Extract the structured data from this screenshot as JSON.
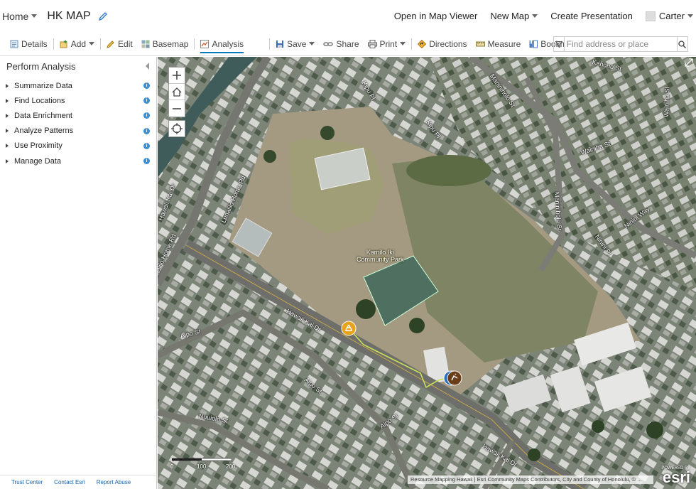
{
  "header": {
    "home_label": "Home",
    "map_title": "HK MAP",
    "open_map_viewer": "Open in Map Viewer",
    "new_map": "New Map",
    "create_presentation": "Create Presentation",
    "user_name": "Carter"
  },
  "toolbar": {
    "details": "Details",
    "add": "Add",
    "edit": "Edit",
    "basemap": "Basemap",
    "analysis": "Analysis",
    "save": "Save",
    "share": "Share",
    "print": "Print",
    "directions": "Directions",
    "measure": "Measure",
    "bookmarks": "Bookmarks",
    "search_placeholder": "Find address or place"
  },
  "panel": {
    "title": "Perform Analysis",
    "items": [
      {
        "label": "Summarize Data"
      },
      {
        "label": "Find Locations"
      },
      {
        "label": "Data Enrichment"
      },
      {
        "label": "Analyze Patterns"
      },
      {
        "label": "Use Proximity"
      },
      {
        "label": "Manage Data"
      }
    ],
    "footer": [
      "Trust Center",
      "Contact Esri",
      "Report Abuse"
    ]
  },
  "map": {
    "park_label_1": "Kamilo Iki",
    "park_label_2": "Community Park",
    "streets": [
      {
        "name": "Kipu Pl"
      },
      {
        "name": "Maniniholo St"
      },
      {
        "name": "Kipu Pl"
      },
      {
        "name": "Hawaii Kai Dr"
      },
      {
        "name": "Aipo St"
      },
      {
        "name": "Aipo St"
      },
      {
        "name": "Aipo St"
      },
      {
        "name": "Nuuiolo St"
      },
      {
        "name": "Hawaii Kai Dr"
      },
      {
        "name": "Lunalilo Home Rd"
      },
      {
        "name": "Wainiha St"
      },
      {
        "name": "Wainiha St"
      },
      {
        "name": "Ninini Pl"
      },
      {
        "name": "Ninini Way"
      },
      {
        "name": "Maniniholo St"
      },
      {
        "name": "Lunalilo Home Rd"
      },
      {
        "name": "Hawaii Kai Dr"
      },
      {
        "name": "Kahono St"
      }
    ],
    "scale_labels": [
      "0",
      "100",
      "200"
    ],
    "attribution": "Resource Mapping Hawaii | Esri Community Maps Contributors, City and County of Honolulu, © ...",
    "powered_by": "POWERED BY",
    "esri_logo": "esri",
    "accent_route": "#c8e05a",
    "marker_orange": "#e8a21c",
    "marker_brown": "#6b3e1a"
  }
}
